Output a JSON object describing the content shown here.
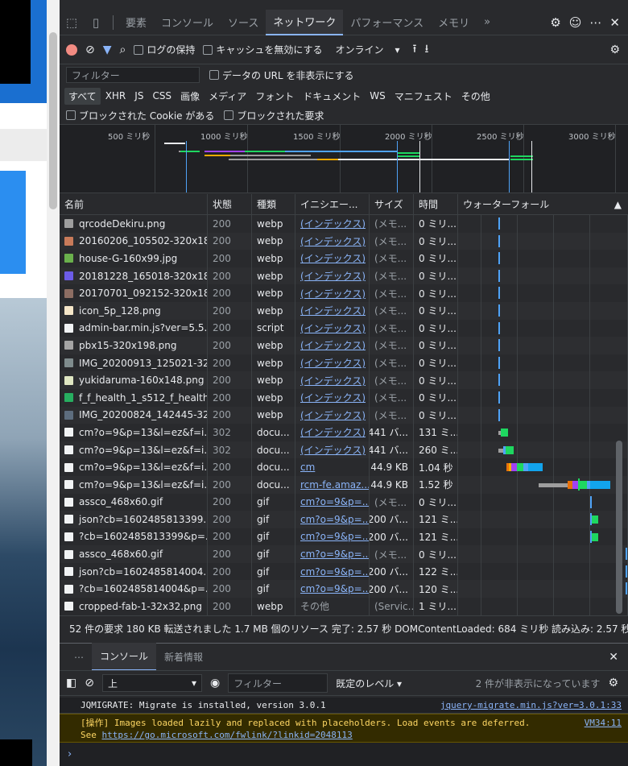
{
  "tabs": [
    "要素",
    "コンソール",
    "ソース",
    "ネットワーク",
    "パフォーマンス",
    "メモリ"
  ],
  "active_tab": "ネットワーク",
  "more_tabs": "»",
  "toolbar": {
    "preserve_log": "ログの保持",
    "disable_cache": "キャッシュを無効にする",
    "throttle": "オンライン"
  },
  "filter": {
    "placeholder": "フィルター",
    "hide_data_urls": "データの URL を非表示にする"
  },
  "types": [
    "すべて",
    "XHR",
    "JS",
    "CSS",
    "画像",
    "メディア",
    "フォント",
    "ドキュメント",
    "WS",
    "マニフェスト",
    "その他"
  ],
  "blocked_cookies": "ブロックされた Cookie がある",
  "blocked_requests": "ブロックされた要求",
  "overview_ticks": [
    {
      "label": "500 ミリ秒"
    },
    {
      "label": "1000 ミリ秒"
    },
    {
      "label": "1500 ミリ秒"
    },
    {
      "label": "2000 ミリ秒"
    },
    {
      "label": "2500 ミリ秒"
    },
    {
      "label": "3000 ミリ秒"
    }
  ],
  "columns": {
    "name": "名前",
    "status": "状態",
    "type": "種類",
    "initiator": "イニシエー...",
    "size": "サイズ",
    "time": "時間",
    "waterfall": "ウォーターフォール"
  },
  "rows": [
    {
      "name": "qrcodeDekiru.png",
      "status": "200",
      "type": "webp",
      "initiator": "(インデックス)",
      "size": "(メモ...",
      "time": "0 ミリ...",
      "icon": "#9e9e9e",
      "wf": [
        [
          20,
          1,
          "#4fa3f7"
        ]
      ]
    },
    {
      "name": "20160206_105502-320x18...",
      "status": "200",
      "type": "webp",
      "initiator": "(インデックス)",
      "size": "(メモ...",
      "time": "0 ミリ...",
      "icon": "#c97b5a",
      "wf": [
        [
          20,
          1,
          "#4fa3f7"
        ]
      ]
    },
    {
      "name": "house-G-160x99.jpg",
      "status": "200",
      "type": "webp",
      "initiator": "(インデックス)",
      "size": "(メモ...",
      "time": "0 ミリ...",
      "icon": "#6ab04c",
      "wf": [
        [
          20,
          1,
          "#4fa3f7"
        ]
      ]
    },
    {
      "name": "20181228_165018-320x18...",
      "status": "200",
      "type": "webp",
      "initiator": "(インデックス)",
      "size": "(メモ...",
      "time": "0 ミリ...",
      "icon": "#6c5ce7",
      "wf": [
        [
          20,
          1,
          "#4fa3f7"
        ]
      ]
    },
    {
      "name": "20170701_092152-320x18...",
      "status": "200",
      "type": "webp",
      "initiator": "(インデックス)",
      "size": "(メモ...",
      "time": "0 ミリ...",
      "icon": "#8d6e63",
      "wf": [
        [
          20,
          1,
          "#4fa3f7"
        ]
      ]
    },
    {
      "name": "icon_5p_128.png",
      "status": "200",
      "type": "webp",
      "initiator": "(インデックス)",
      "size": "(メモ...",
      "time": "0 ミリ...",
      "icon": "#f5e6c8",
      "wf": [
        [
          20,
          1,
          "#4fa3f7"
        ]
      ]
    },
    {
      "name": "admin-bar.min.js?ver=5.5....",
      "status": "200",
      "type": "script",
      "initiator": "(インデックス)",
      "size": "(メモ...",
      "time": "0 ミリ...",
      "icon": "#f1f3f4",
      "wf": [
        [
          20,
          1,
          "#4fa3f7"
        ]
      ]
    },
    {
      "name": "pbx15-320x198.png",
      "status": "200",
      "type": "webp",
      "initiator": "(インデックス)",
      "size": "(メモ...",
      "time": "0 ミリ...",
      "icon": "#a5a5a5",
      "wf": [
        [
          20,
          1,
          "#4fa3f7"
        ]
      ]
    },
    {
      "name": "IMG_20200913_125021-32...",
      "status": "200",
      "type": "webp",
      "initiator": "(インデックス)",
      "size": "(メモ...",
      "time": "0 ミリ...",
      "icon": "#7f8c8d",
      "wf": [
        [
          20,
          1,
          "#4fa3f7"
        ]
      ]
    },
    {
      "name": "yukidaruma-160x148.png",
      "status": "200",
      "type": "webp",
      "initiator": "(インデックス)",
      "size": "(メモ...",
      "time": "0 ミリ...",
      "icon": "#dfe6c2",
      "wf": [
        [
          20,
          1,
          "#4fa3f7"
        ]
      ]
    },
    {
      "name": "f_f_health_1_s512_f_health...",
      "status": "200",
      "type": "webp",
      "initiator": "(インデックス)",
      "size": "(メモ...",
      "time": "0 ミリ...",
      "icon": "#27ae60",
      "wf": [
        [
          20,
          1,
          "#4fa3f7"
        ]
      ]
    },
    {
      "name": "IMG_20200824_142445-32...",
      "status": "200",
      "type": "webp",
      "initiator": "(インデックス)",
      "size": "(メモ...",
      "time": "0 ミリ...",
      "icon": "#5d6d7e",
      "wf": [
        [
          20,
          1,
          "#4fa3f7"
        ]
      ]
    },
    {
      "name": "cm?o=9&p=13&l=ez&f=i...",
      "status": "302",
      "type": "docu...",
      "initiator": "(インデックス)",
      "size": "441 バ...",
      "time": "131 ミ...",
      "icon": "#f1f3f4",
      "wf": [
        [
          20,
          3,
          "#9e9e9e"
        ],
        [
          23,
          9,
          "#1ed760"
        ]
      ]
    },
    {
      "name": "cm?o=9&p=13&l=ez&f=i...",
      "status": "302",
      "type": "docu...",
      "initiator": "(インデックス)",
      "size": "441 バ...",
      "time": "260 ミ...",
      "icon": "#f1f3f4",
      "wf": [
        [
          20,
          6,
          "#9e9e9e"
        ],
        [
          26,
          3,
          "#4fa3f7"
        ],
        [
          29,
          10,
          "#1ed760"
        ]
      ]
    },
    {
      "name": "cm?o=9&p=13&l=ez&f=i...",
      "status": "200",
      "type": "docu...",
      "initiator": "cm",
      "size": "44.9 KB",
      "time": "1.04 秒",
      "icon": "#f1f3f4",
      "wf": [
        [
          30,
          3,
          "#e8710a"
        ],
        [
          33,
          3,
          "#f9ab00"
        ],
        [
          36,
          7,
          "#a142f4"
        ],
        [
          43,
          8,
          "#1ed760"
        ],
        [
          51,
          6,
          "#4fa3f7"
        ],
        [
          57,
          18,
          "#12a4ed"
        ]
      ]
    },
    {
      "name": "cm?o=9&p=13&l=ez&f=i...",
      "status": "200",
      "type": "docu...",
      "initiator": "rcm-fe.amaz...",
      "size": "44.9 KB",
      "time": "1.52 秒",
      "icon": "#f1f3f4",
      "wf": [
        [
          70,
          36,
          "#9e9e9e"
        ],
        [
          106,
          6,
          "#e8710a"
        ],
        [
          112,
          7,
          "#a142f4"
        ],
        [
          119,
          2,
          "#1ed760"
        ],
        [
          121,
          9,
          "#1ed760"
        ],
        [
          130,
          4,
          "#4fa3f7"
        ],
        [
          134,
          25,
          "#12a4ed"
        ]
      ]
    },
    {
      "name": "assco_468x60.gif",
      "status": "200",
      "type": "gif",
      "initiator": "cm?o=9&p=...",
      "size": "(メモ...",
      "time": "0 ミリ...",
      "icon": "#f1f3f4",
      "wf": [
        [
          134,
          1,
          "#4fa3f7"
        ]
      ]
    },
    {
      "name": "json?cb=1602485813399...",
      "status": "200",
      "type": "gif",
      "initiator": "cm?o=9&p=...",
      "size": "200 バ...",
      "time": "121 ミ...",
      "icon": "#f1f3f4",
      "wf": [
        [
          134,
          2,
          "#4fa3f7"
        ],
        [
          136,
          8,
          "#1ed760"
        ]
      ]
    },
    {
      "name": "?cb=1602485813399&p=...",
      "status": "200",
      "type": "gif",
      "initiator": "cm?o=9&p=...",
      "size": "200 バ...",
      "time": "121 ミ...",
      "icon": "#f1f3f4",
      "wf": [
        [
          134,
          2,
          "#4fa3f7"
        ],
        [
          136,
          8,
          "#1ed760"
        ]
      ]
    },
    {
      "name": "assco_468x60.gif",
      "status": "200",
      "type": "gif",
      "initiator": "cm?o=9&p=...",
      "size": "(メモ...",
      "time": "0 ミリ...",
      "icon": "#f1f3f4",
      "wf": [
        [
          178,
          1,
          "#4fa3f7"
        ]
      ]
    },
    {
      "name": "json?cb=1602485814004...",
      "status": "200",
      "type": "gif",
      "initiator": "cm?o=9&p=...",
      "size": "200 バ...",
      "time": "122 ミ...",
      "icon": "#f1f3f4",
      "wf": [
        [
          178,
          2,
          "#4fa3f7"
        ],
        [
          180,
          9,
          "#1ed760"
        ]
      ]
    },
    {
      "name": "?cb=1602485814004&p=...",
      "status": "200",
      "type": "gif",
      "initiator": "cm?o=9&p=...",
      "size": "200 バ...",
      "time": "120 ミ...",
      "icon": "#f1f3f4",
      "wf": [
        [
          178,
          2,
          "#4fa3f7"
        ],
        [
          180,
          9,
          "#1ed760"
        ]
      ]
    },
    {
      "name": "cropped-fab-1-32x32.png",
      "status": "200",
      "type": "webp",
      "initiator": "その他",
      "size": "(Servic...",
      "time": "1 ミリ...",
      "icon": "#f1f3f4",
      "wf": [
        [
          188,
          1,
          "#4fa3f7"
        ]
      ]
    }
  ],
  "summary": "52 件の要求  180 KB 転送されました  1.7 MB 個のリソース  完了: 2.57 秒  DOMContentLoaded: 684 ミリ秒  読み込み: 2.57 秒",
  "drawer": {
    "tabs": [
      "コンソール",
      "新着情報"
    ],
    "context": "上",
    "filter_placeholder": "フィルター",
    "level": "既定のレベル ▾",
    "hidden_count": "2 件が非表示になっています"
  },
  "console_messages": {
    "log_text": "JQMIGRATE: Migrate is installed, version 3.0.1",
    "log_source": "jquery-migrate.min.js?ver=3.0.1:33",
    "warn_text": "[操作] Images loaded lazily and replaced with placeholders. Load events are deferred.",
    "warn_source": "VM34:11",
    "warn_see": "See ",
    "warn_link": "https://go.microsoft.com/fwlink/?linkid=2048113"
  },
  "prompt": "›"
}
